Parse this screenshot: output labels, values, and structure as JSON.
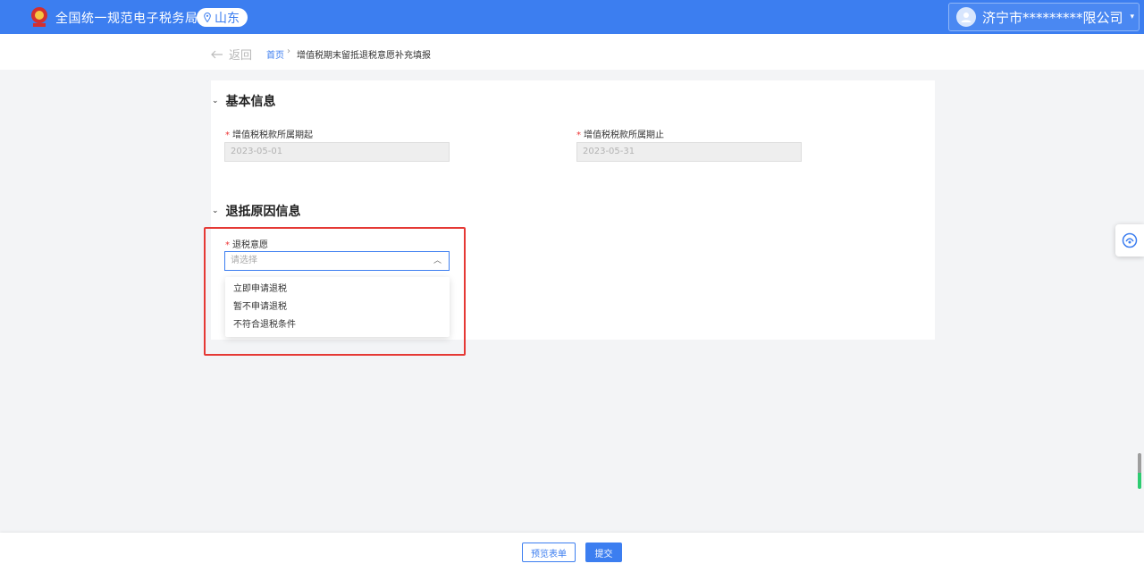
{
  "header": {
    "site_title": "全国统一规范电子税务局",
    "region": "山东",
    "account_name": "济宁市*********限公司",
    "caret": "▾",
    "brand_color": "#3c7ef0"
  },
  "breadcrumb": {
    "back_label": "返回",
    "home": "首页",
    "separator": "›",
    "current": "增值税期末留抵退税意愿补充填报"
  },
  "basic_info": {
    "title": "基本信息",
    "period_start_label": "增值税税款所属期起",
    "period_start_value": "2023-05-01",
    "period_end_label": "增值税税款所属期止",
    "period_end_value": "2023-05-31"
  },
  "refund_reason": {
    "title": "退抵原因信息",
    "intent_label": "退税意愿",
    "placeholder": "请选择",
    "options": [
      "立即申请退税",
      "暂不申请退税",
      "不符合退税条件"
    ]
  },
  "required_mark": "*",
  "footer": {
    "preview_label": "预览表单",
    "submit_label": "提交"
  }
}
